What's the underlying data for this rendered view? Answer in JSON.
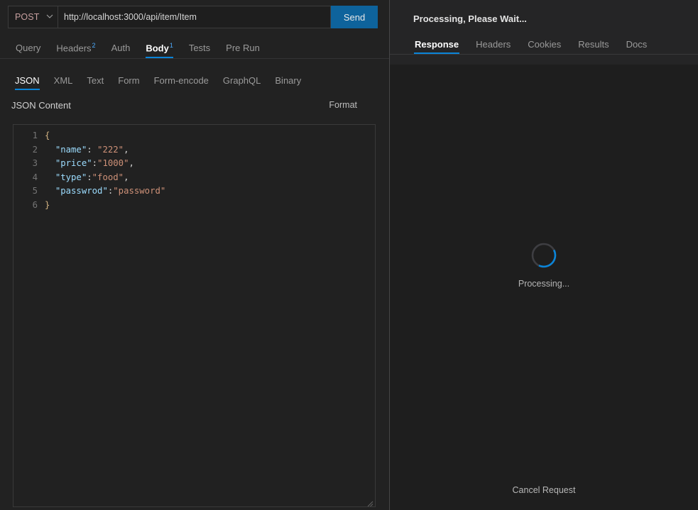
{
  "request": {
    "method": "POST",
    "method_chevron_icon": "chevron-down-icon",
    "url": "http://localhost:3000/api/item/Item",
    "url_placeholder": "Enter URL",
    "send_label": "Send",
    "tabs": [
      {
        "label": "Query",
        "badge": ""
      },
      {
        "label": "Headers",
        "badge": "2"
      },
      {
        "label": "Auth",
        "badge": ""
      },
      {
        "label": "Body",
        "badge": "1"
      },
      {
        "label": "Tests",
        "badge": ""
      },
      {
        "label": "Pre Run",
        "badge": ""
      }
    ],
    "body_types": [
      {
        "label": "JSON"
      },
      {
        "label": "XML"
      },
      {
        "label": "Text"
      },
      {
        "label": "Form"
      },
      {
        "label": "Form-encode"
      },
      {
        "label": "GraphQL"
      },
      {
        "label": "Binary"
      }
    ],
    "content_title": "JSON Content",
    "format_label": "Format",
    "editor": {
      "lines": [
        {
          "no": "1",
          "tokens": [
            {
              "t": "{",
              "c": "punc"
            }
          ]
        },
        {
          "no": "2",
          "tokens": [
            {
              "t": "  ",
              "c": "plain"
            },
            {
              "t": "\"name\"",
              "c": "key"
            },
            {
              "t": ": ",
              "c": "colon"
            },
            {
              "t": "\"222\"",
              "c": "str"
            },
            {
              "t": ",",
              "c": "comma"
            }
          ]
        },
        {
          "no": "3",
          "tokens": [
            {
              "t": "  ",
              "c": "plain"
            },
            {
              "t": "\"price\"",
              "c": "key"
            },
            {
              "t": ":",
              "c": "colon"
            },
            {
              "t": "\"1000\"",
              "c": "str"
            },
            {
              "t": ",",
              "c": "comma"
            }
          ]
        },
        {
          "no": "4",
          "tokens": [
            {
              "t": "  ",
              "c": "plain"
            },
            {
              "t": "\"type\"",
              "c": "key"
            },
            {
              "t": ":",
              "c": "colon"
            },
            {
              "t": "\"food\"",
              "c": "str"
            },
            {
              "t": ",",
              "c": "comma"
            }
          ]
        },
        {
          "no": "5",
          "tokens": [
            {
              "t": "  ",
              "c": "plain"
            },
            {
              "t": "\"passwrod\"",
              "c": "key"
            },
            {
              "t": ":",
              "c": "colon"
            },
            {
              "t": "\"password\"",
              "c": "str"
            }
          ]
        },
        {
          "no": "6",
          "tokens": [
            {
              "t": "}",
              "c": "punc"
            }
          ]
        }
      ]
    },
    "resize_grip_icon": "resize-grip-icon"
  },
  "response": {
    "status_text": "Processing, Please Wait...",
    "tabs": [
      {
        "label": "Response"
      },
      {
        "label": "Headers"
      },
      {
        "label": "Cookies"
      },
      {
        "label": "Results"
      },
      {
        "label": "Docs"
      }
    ],
    "spinner_icon": "loading-spinner-icon",
    "spinner_label": "Processing...",
    "cancel_label": "Cancel Request"
  },
  "colors": {
    "accent": "#0a84d8",
    "send_button": "#0e639c",
    "badge": "#4daafc",
    "json_key": "#9cdcfe",
    "json_string": "#ce9178",
    "json_punct": "#d4b483",
    "panel_bg": "#222222",
    "response_bg": "#1e1e1e"
  }
}
